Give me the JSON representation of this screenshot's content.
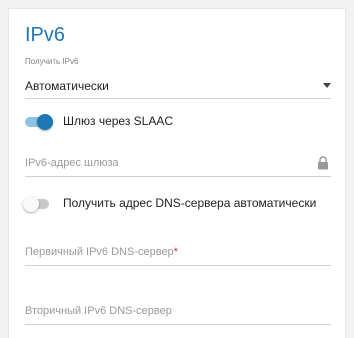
{
  "section": {
    "title": "IPv6"
  },
  "obtain_ipv6": {
    "label": "Получить IPv6",
    "value": "Автоматически"
  },
  "slaac_gateway": {
    "label": "Шлюз через SLAAC",
    "enabled": true
  },
  "gateway_address": {
    "placeholder": "IPv6-адрес шлюза"
  },
  "dns_auto": {
    "label": "Получить адрес DNS-сервера автоматически",
    "enabled": false
  },
  "primary_dns": {
    "placeholder": "Первичный IPv6 DNS-сервер",
    "required_mark": "*"
  },
  "secondary_dns": {
    "placeholder": "Вторичный IPv6 DNS-сервер"
  },
  "colors": {
    "accent": "#1e78b4",
    "required": "#e0312c"
  }
}
